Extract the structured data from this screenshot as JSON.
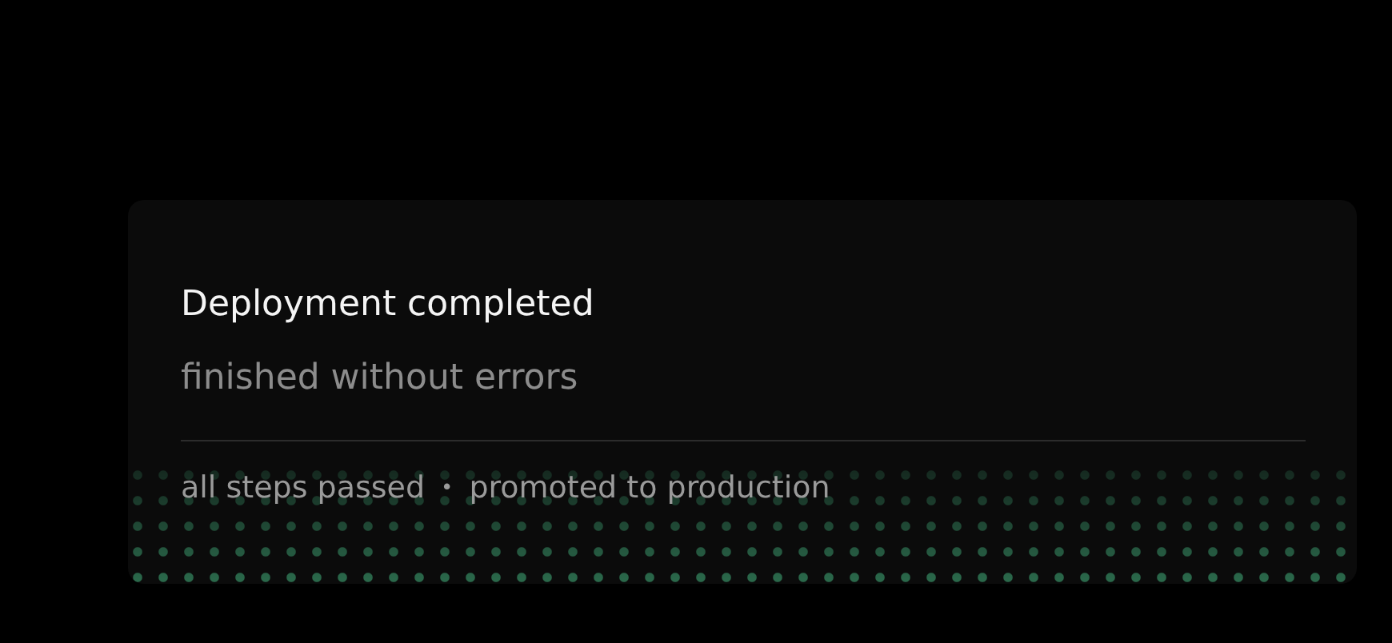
{
  "toast": {
    "title": "Deployment completed",
    "subtitle": "finished without errors",
    "footer": {
      "items": [
        "all steps passed",
        "promoted to production"
      ],
      "separator": "•"
    }
  }
}
